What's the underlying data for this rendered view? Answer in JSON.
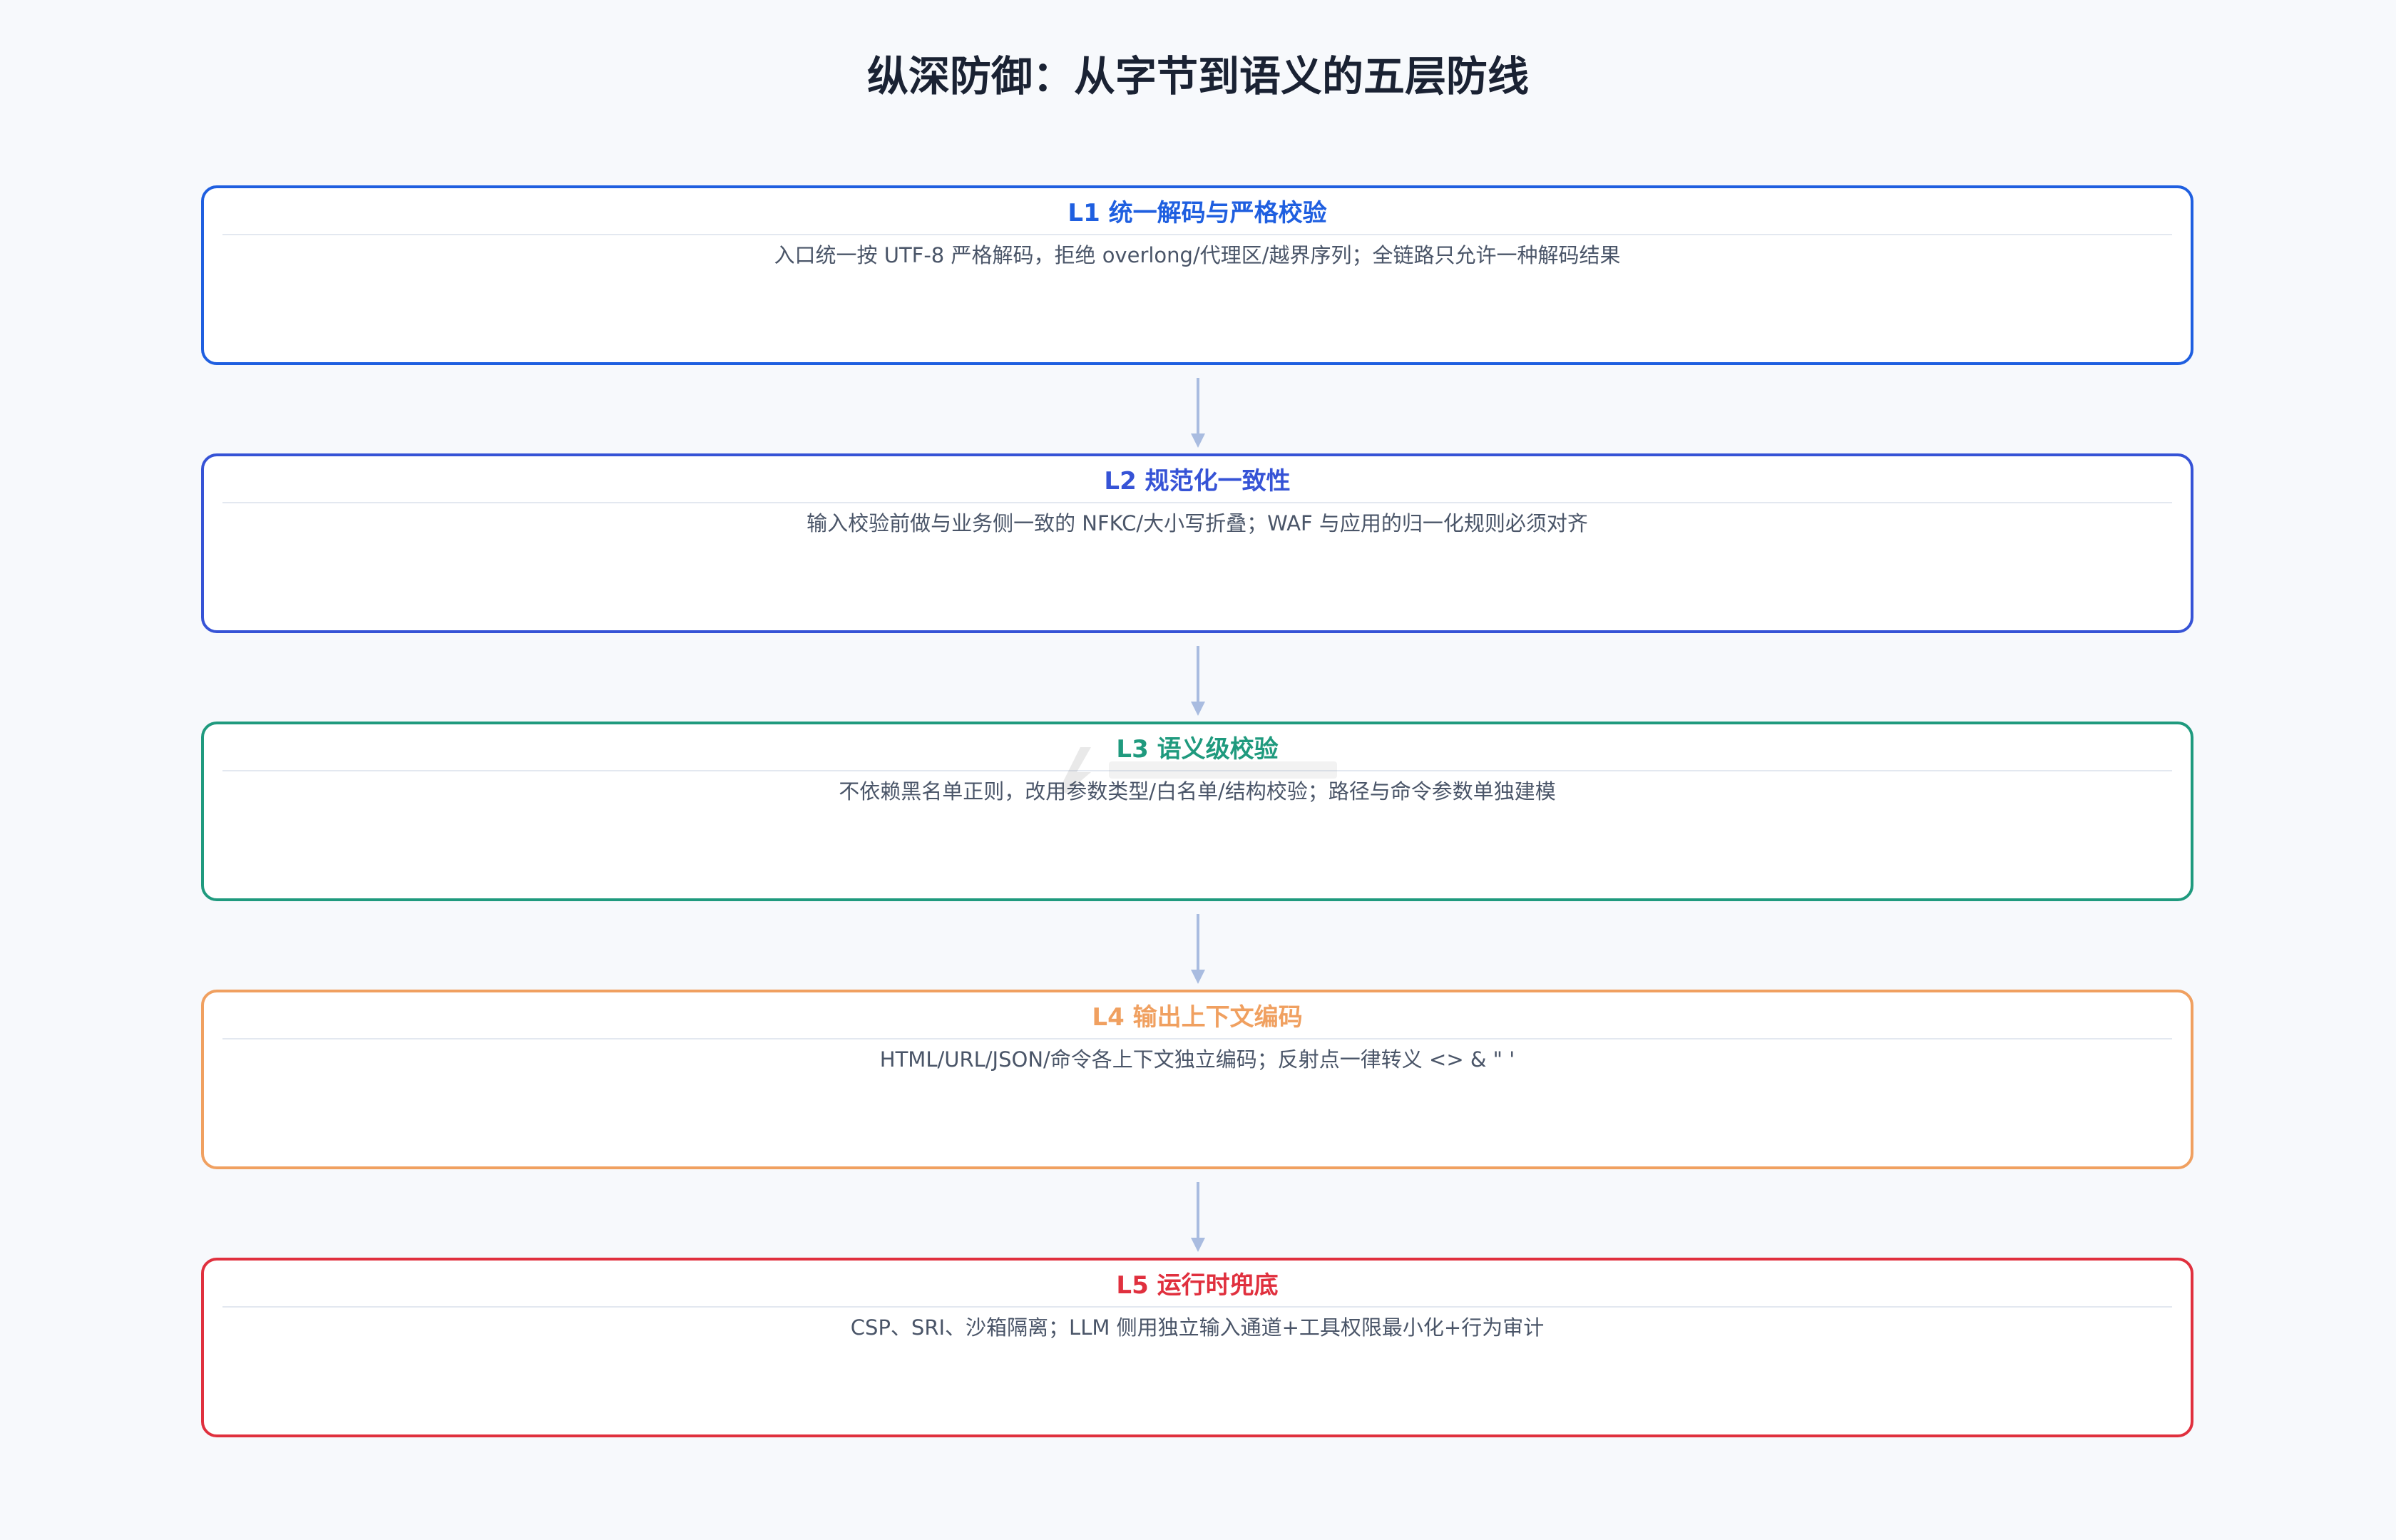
{
  "title": "纵深防御：从字节到语义的五层防线",
  "layers": [
    {
      "title": "L1 统一解码与严格校验",
      "desc": "入口统一按 UTF-8 严格解码，拒绝 overlong/代理区/越界序列；全链路只允许一种解码结果",
      "color": "#1f5fe0"
    },
    {
      "title": "L2 规范化一致性",
      "desc": "输入校验前做与业务侧一致的 NFKC/大小写折叠；WAF 与应用的归一化规则必须对齐",
      "color": "#3653d6"
    },
    {
      "title": "L3 语义级校验",
      "desc": "不依赖黑名单正则，改用参数类型/白名单/结构校验；路径与命令参数单独建模",
      "color": "#1f9a7e"
    },
    {
      "title": "L4 输出上下文编码",
      "desc": "HTML/URL/JSON/命令各上下文独立编码；反射点一律转义 <> & \" '",
      "color": "#f0a060"
    },
    {
      "title": "L5 运行时兜底",
      "desc": "CSP、SRI、沙箱隔离；LLM 侧用独立输入通道+工具权限最小化+行为审计",
      "color": "#e0303e"
    }
  ],
  "arrow_color": "#a9bce0"
}
